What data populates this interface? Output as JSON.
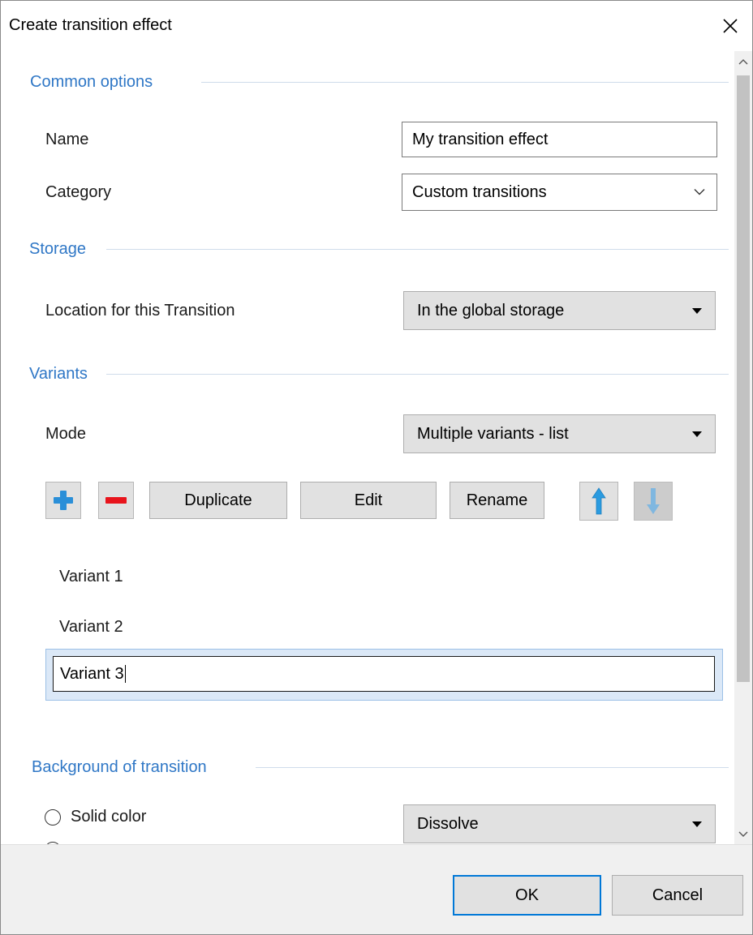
{
  "window": {
    "title": "Create transition effect"
  },
  "sections": {
    "common": "Common options",
    "storage": "Storage",
    "variants": "Variants",
    "background": "Background of transition"
  },
  "fields": {
    "name_label": "Name",
    "name_value": "My transition effect",
    "category_label": "Category",
    "category_value": "Custom transitions",
    "location_label": "Location for this Transition",
    "location_value": "In the global storage",
    "mode_label": "Mode",
    "mode_value": "Multiple variants - list"
  },
  "toolbar": {
    "duplicate": "Duplicate",
    "edit": "Edit",
    "rename": "Rename"
  },
  "variants": {
    "items": [
      "Variant 1",
      "Variant 2"
    ],
    "editing_value": "Variant 3"
  },
  "background": {
    "solid_color": "Solid color",
    "effect_value": "Dissolve"
  },
  "footer": {
    "ok": "OK",
    "cancel": "Cancel"
  },
  "colors": {
    "accent": "#2f77c6",
    "add_icon": "#2a8fd8",
    "remove_icon": "#e8141c",
    "up_arrow": "#2a9be0",
    "down_arrow_disabled": "#7fb7e0"
  }
}
